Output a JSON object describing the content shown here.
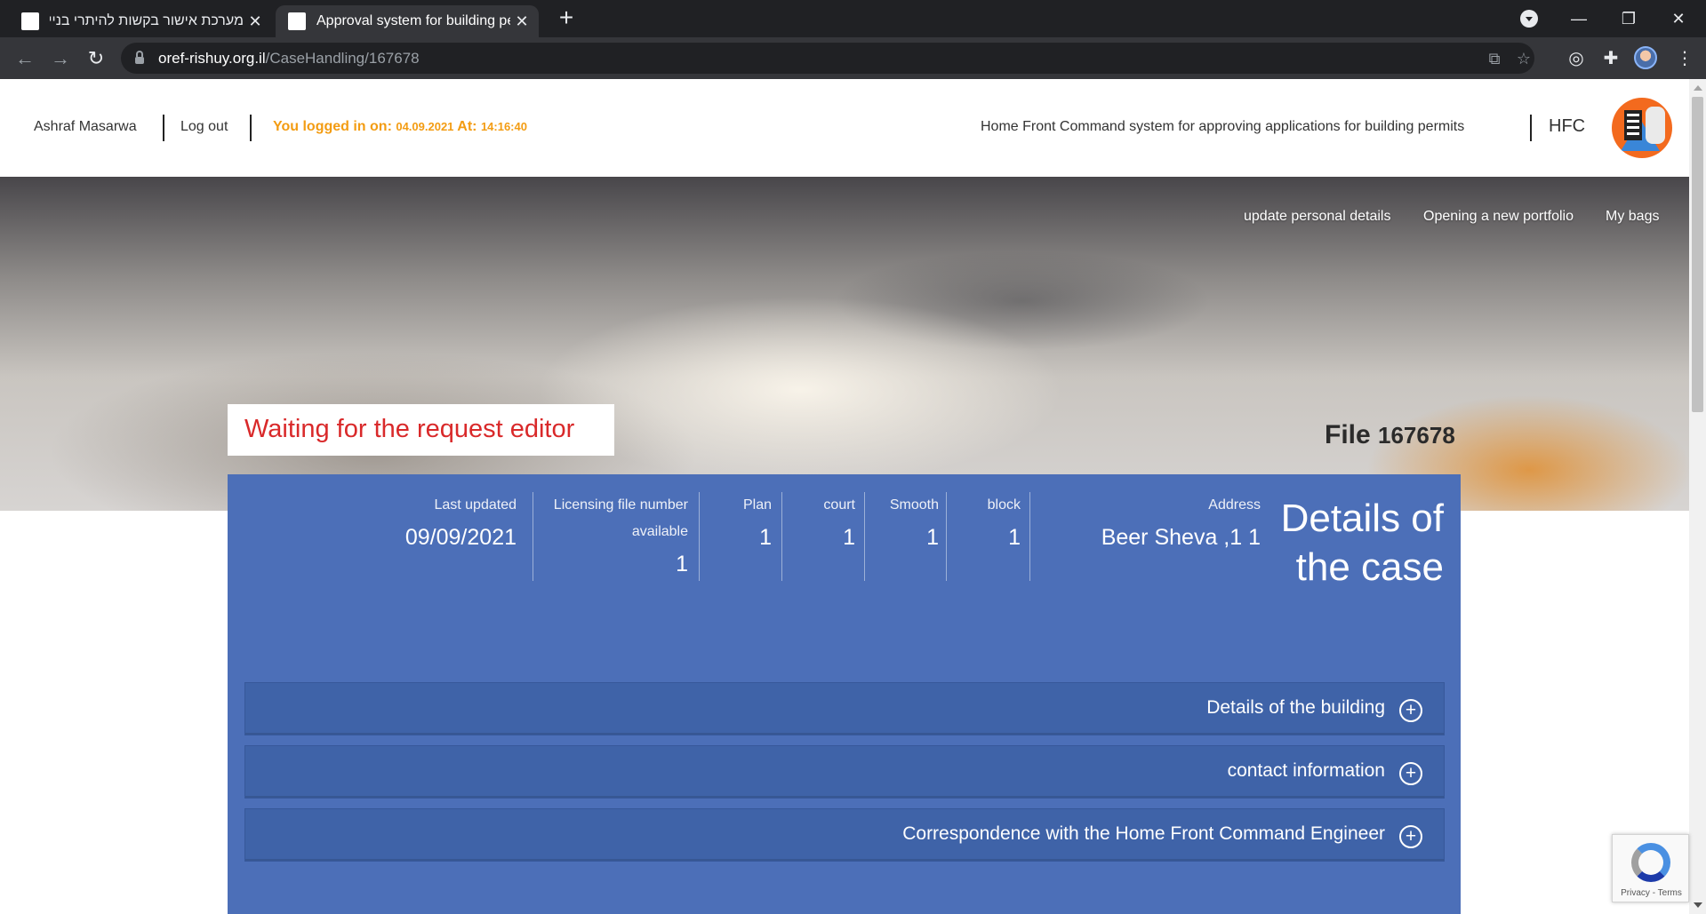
{
  "browser": {
    "tabs": [
      {
        "title": "מערכת אישור בקשות להיתרי בניי",
        "active": false
      },
      {
        "title": "Approval system for building per",
        "active": true
      }
    ],
    "url_host": "oref-rishuy.org.il",
    "url_path": "/CaseHandling/167678"
  },
  "header": {
    "user_name": "Ashraf Masarwa",
    "logout": "Log out",
    "logged_in_label": "You logged in on: ",
    "logged_in_date": "04.09.2021",
    "logged_in_at": " At: ",
    "logged_in_time": "14:16:40",
    "system_title": "Home Front Command system for approving applications for building permits",
    "hfc": "HFC"
  },
  "hero_nav": {
    "update_details": "update personal details",
    "new_portfolio": "Opening a new portfolio",
    "my_bags": "My bags"
  },
  "case": {
    "status": "Waiting for the request editor",
    "file_label": "File ",
    "file_number": "167678",
    "details_title": "Details of the case",
    "fields": {
      "last_updated": {
        "label": "Last updated",
        "value": "09/09/2021"
      },
      "licensing_file": {
        "label": "Licensing file number available",
        "value": "1"
      },
      "plan": {
        "label": "Plan",
        "value": "1"
      },
      "court": {
        "label": "court",
        "value": "1"
      },
      "smooth": {
        "label": "Smooth",
        "value": "1"
      },
      "block": {
        "label": "block",
        "value": "1"
      },
      "address": {
        "label": "Address",
        "value": "Beer Sheva ,1 1"
      }
    }
  },
  "accordion": {
    "building": "Details of the building",
    "contact": "contact information",
    "correspondence": "Correspondence with the Home Front Command Engineer"
  },
  "recaptcha": {
    "text": "Privacy - Terms"
  },
  "colors": {
    "panel": "#4c6fb8",
    "accordion": "#3f63a8",
    "status_red": "#d9292a",
    "logged_orange": "#f39c12",
    "logo_orange": "#f36a1e"
  }
}
